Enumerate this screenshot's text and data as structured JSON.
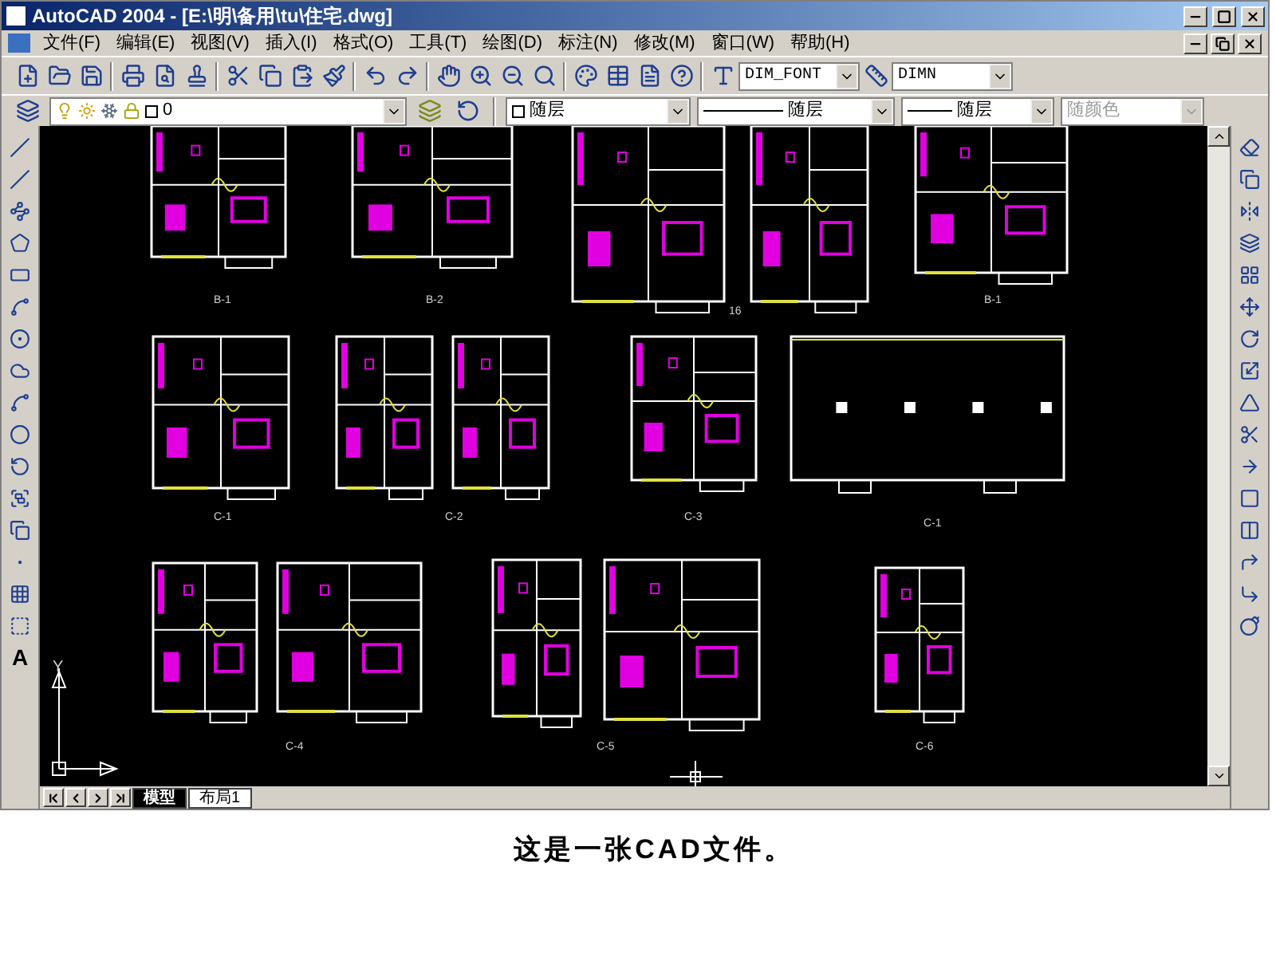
{
  "window": {
    "title": "AutoCAD 2004 - [E:\\明\\备用\\tu\\住宅.dwg]"
  },
  "menu": [
    "文件(F)",
    "编辑(E)",
    "视图(V)",
    "插入(I)",
    "格式(O)",
    "工具(T)",
    "绘图(D)",
    "标注(N)",
    "修改(M)",
    "窗口(W)",
    "帮助(H)"
  ],
  "styles_toolbar": {
    "text_style": "DIM_FONT",
    "dim_style": "DIMN"
  },
  "layers_toolbar": {
    "layer": "0",
    "color_control": "随层",
    "linetype": "随层",
    "lineweight": "随层",
    "plot_style": {
      "value": "随颜色",
      "disabled": true
    }
  },
  "draw_toolbar": {
    "text_tool": "A"
  },
  "drawing": {
    "ucs_axis": "Y",
    "plans": [
      {
        "label": "B-1"
      },
      {
        "label": "B-2"
      },
      {
        "label": "16"
      },
      {
        "label": "B-1"
      },
      {
        "label": "C-1"
      },
      {
        "label": "C-2"
      },
      {
        "label": "C-3"
      },
      {
        "label": "C-1"
      },
      {
        "label": "C-4"
      },
      {
        "label": "C-5"
      },
      {
        "label": "C-6"
      }
    ]
  },
  "tabs": [
    {
      "label": "模型",
      "selected": true
    },
    {
      "label": "布局1",
      "selected": false
    }
  ],
  "caption": "这是一张CAD文件。"
}
